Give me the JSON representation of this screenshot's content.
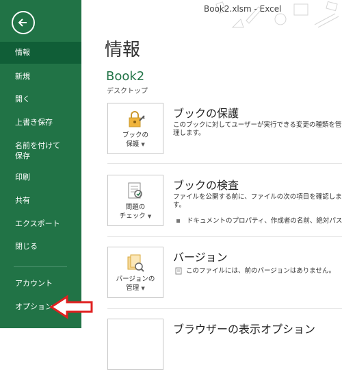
{
  "window": {
    "title": "Book2.xlsm - Excel"
  },
  "sidebar": {
    "back_icon": "back-arrow-icon",
    "items": [
      {
        "label": "情報",
        "active": true
      },
      {
        "label": "新規"
      },
      {
        "label": "開く"
      },
      {
        "label": "上書き保存"
      },
      {
        "label": "名前を付けて\n保存"
      },
      {
        "label": "印刷"
      },
      {
        "label": "共有"
      },
      {
        "label": "エクスポート"
      },
      {
        "label": "閉じる"
      },
      {
        "label": "アカウント"
      },
      {
        "label": "オプション"
      }
    ]
  },
  "main": {
    "title": "情報",
    "book_name": "Book2",
    "book_location": "デスクトップ",
    "sections": [
      {
        "tile_line1": "ブックの",
        "tile_line2": "保護",
        "title": "ブックの保護",
        "desc": "このブックに対してユーザーが実行できる変更の種類を管理します。"
      },
      {
        "tile_line1": "問題の",
        "tile_line2": "チェック",
        "title": "ブックの検査",
        "desc": "ファイルを公開する前に、ファイルの次の項目を確認します。",
        "sub": "ドキュメントのプロパティ、作成者の名前、絶対パス"
      },
      {
        "tile_line1": "バージョンの",
        "tile_line2": "管理",
        "title": "バージョン",
        "desc": "このファイルには、前のバージョンはありません。"
      },
      {
        "title": "ブラウザーの表示オプション"
      }
    ]
  },
  "colors": {
    "accent": "#217346",
    "active": "#105e37",
    "arrow": "#e02020"
  }
}
